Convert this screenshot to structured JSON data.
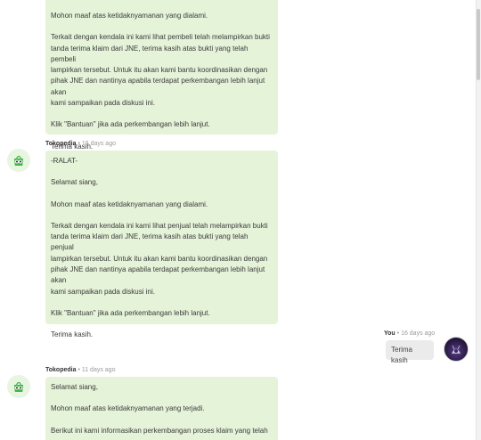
{
  "messages": [
    {
      "paragraphs": [
        "Mohon maaf atas ketidaknyamanan yang dialami.",
        "Terkait dengan kendala ini kami lihat pembeli telah melampirkan bukti\ntanda terima klaim dari JNE, terima kasih atas bukti yang telah pembeli\nlampirkan tersebut. Untuk itu akan kami bantu koordinasikan dengan\npihak JNE dan nantinya apabila terdapat perkembangan lebih lanjut akan\nkami sampaikan pada diskusi ini.",
        "Klik \"Bantuan\" jika ada perkembangan lebih lanjut.",
        "Terima kasih."
      ]
    },
    {
      "sender": "Tokopedia",
      "time": "16 days ago",
      "paragraphs": [
        "-RALAT-",
        "Selamat siang,",
        "Mohon maaf atas ketidaknyamanan yang dialami.",
        "Terkait dengan kendala ini kami lihat penjual telah melampirkan bukti\ntanda terima klaim dari JNE, terima kasih atas bukti yang telah penjual\nlampirkan tersebut. Untuk itu akan kami bantu koordinasikan dengan\npihak JNE dan nantinya apabila terdapat perkembangan lebih lanjut akan\nkami sampaikan pada diskusi ini.",
        "Klik \"Bantuan\" jika ada perkembangan lebih lanjut.",
        "Terima kasih."
      ]
    },
    {
      "sender": "You",
      "time": "16 days ago",
      "text": "Terima kasih"
    },
    {
      "sender": "Tokopedia",
      "time": "11 days ago",
      "paragraphs": [
        "Selamat siang,",
        "Mohon maaf atas ketidaknyamanan yang terjadi.",
        "Berikut ini kami informasikan perkembangan proses klaim yang telah"
      ]
    }
  ],
  "colors": {
    "bubble_other": "#e5f3d9",
    "bubble_self": "#ebebeb",
    "tokopedia_green": "#42b549"
  },
  "icons": {
    "tokopedia_avatar": "tokopedia-owl-logo-icon",
    "user_avatar": "user-profile-photo"
  }
}
